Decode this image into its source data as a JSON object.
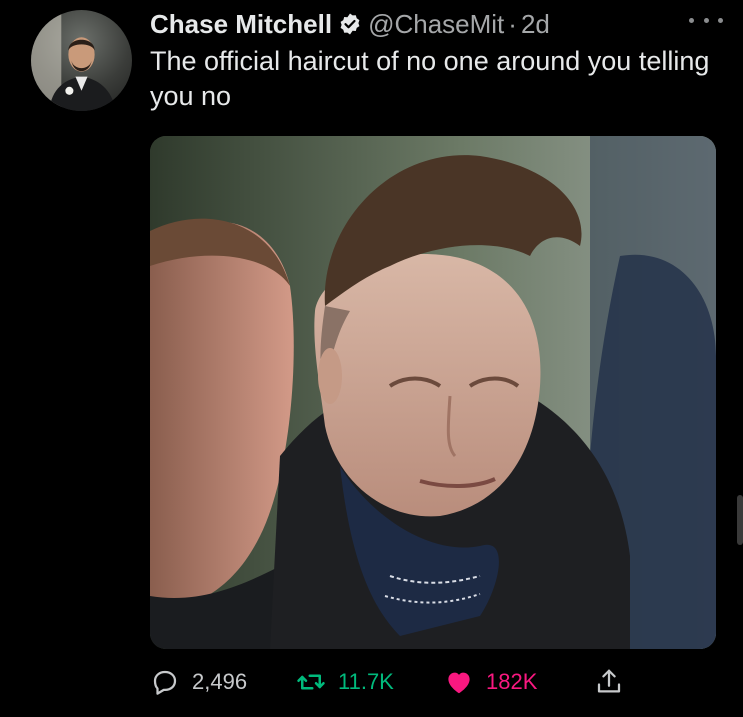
{
  "tweet": {
    "author_name": "Chase Mitchell",
    "handle": "@ChaseMit",
    "separator": "·",
    "time": "2d",
    "text": "The official haircut of no one around you telling you no"
  },
  "icons": {
    "verified": "verified-badge-icon",
    "more": "more-options-icon",
    "reply": "reply-icon",
    "retweet": "retweet-icon",
    "like": "heart-icon",
    "share": "share-icon"
  },
  "stats": {
    "replies": "2,496",
    "retweets": "11.7K",
    "likes": "182K"
  },
  "colors": {
    "background": "#000000",
    "text": "#e7e9ea",
    "muted": "#a5a7a9",
    "retweet": "#00ba7c",
    "like": "#f91880"
  }
}
